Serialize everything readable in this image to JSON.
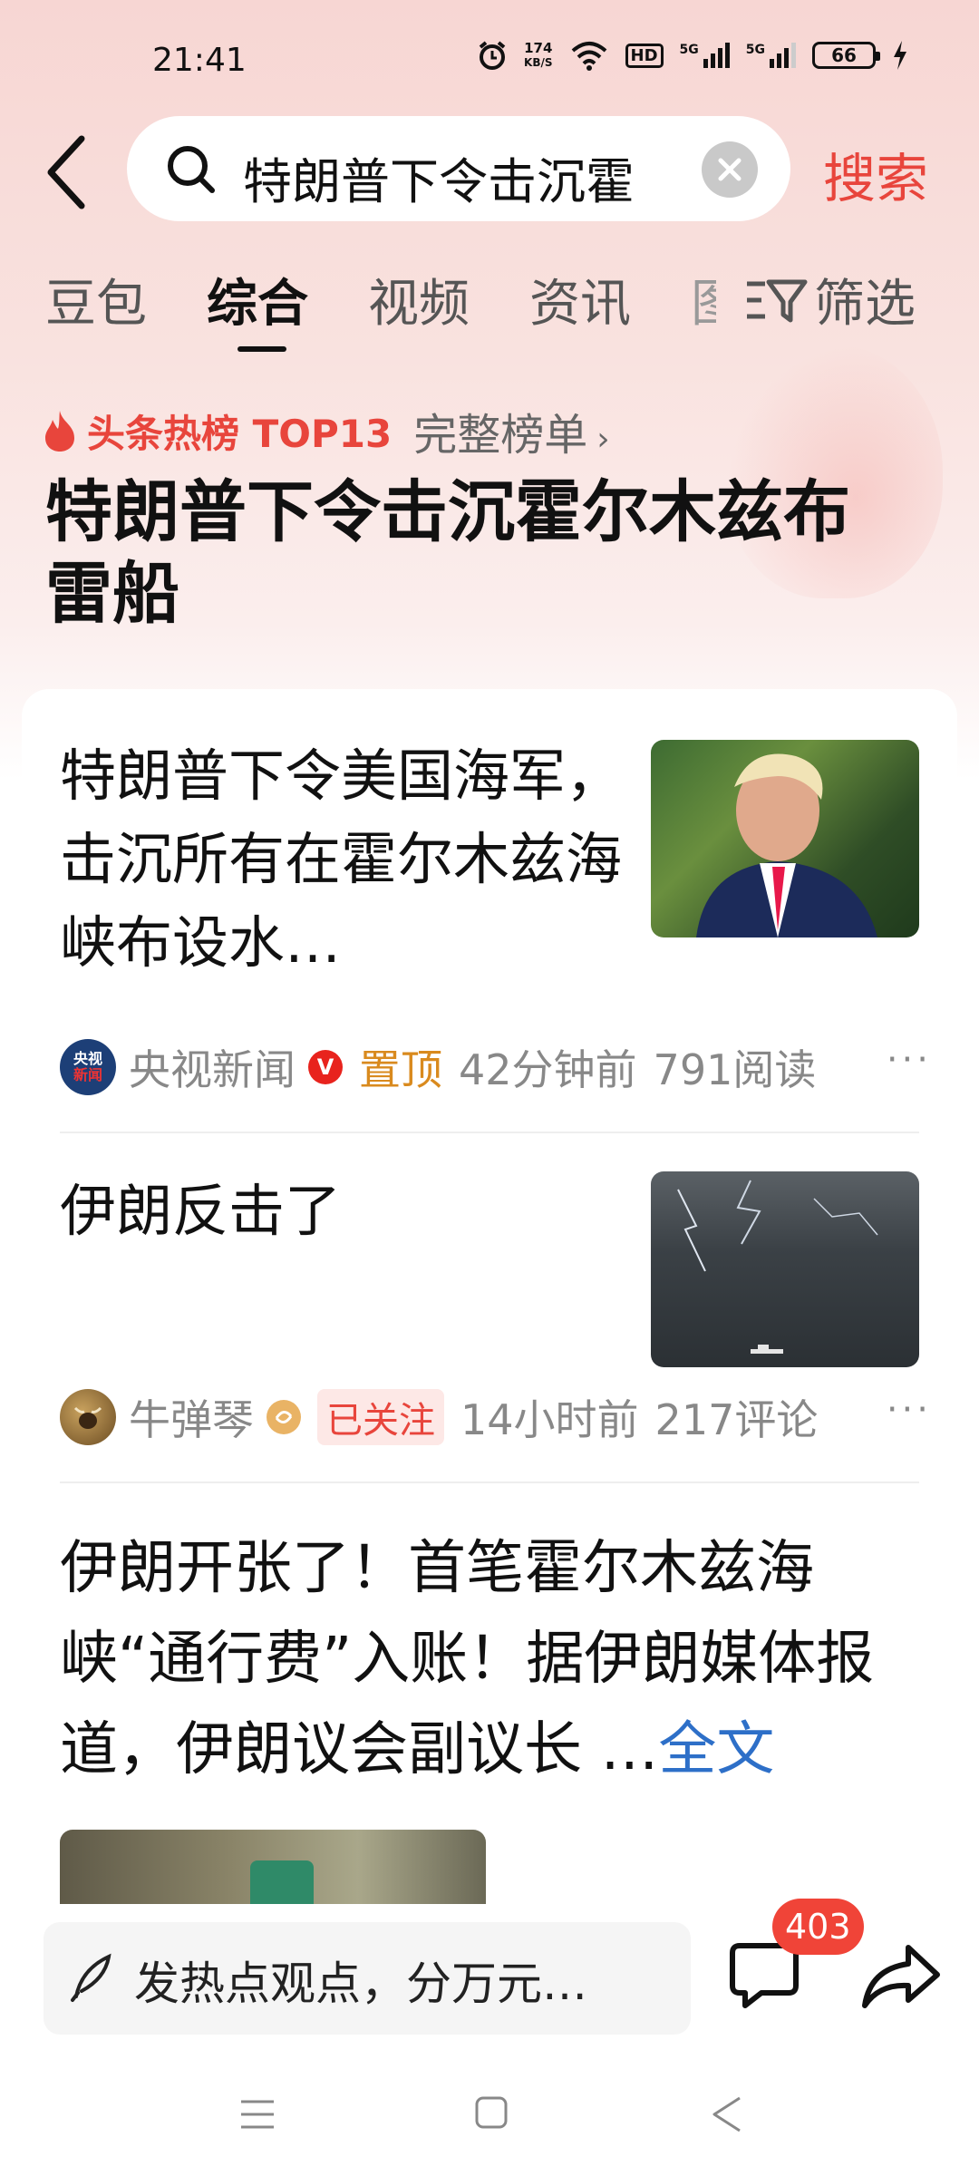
{
  "status_bar": {
    "time": "21:41",
    "net_speed_value": "174",
    "net_speed_unit": "KB/S",
    "hd_label": "HD",
    "signal1": "5G",
    "signal2": "5G",
    "battery": "66"
  },
  "search": {
    "query": "特朗普下令击沉霍",
    "submit_label": "搜索"
  },
  "tabs": {
    "items": [
      {
        "label": "豆包"
      },
      {
        "label": "综合"
      },
      {
        "label": "视频"
      },
      {
        "label": "资讯"
      },
      {
        "label": "图"
      }
    ],
    "active_index": 1,
    "filter_label": "筛选"
  },
  "hot": {
    "tag": "头条热榜 TOP13",
    "more_label": "完整榜单",
    "title": "特朗普下令击沉霍尔木兹布雷船"
  },
  "articles": [
    {
      "title": "特朗普下令美国海军，击沉所有在霍尔木兹海峡布设水…",
      "source": "央视新闻",
      "avatar_text1": "央视",
      "avatar_text2": "新闻",
      "verified_mark": "V",
      "pin_label": "置顶",
      "time": "42分钟前",
      "stat": "791阅读",
      "more": "···"
    },
    {
      "title": "伊朗反击了",
      "source": "牛弹琴",
      "follow_label": "已关注",
      "time": "14小时前",
      "stat": "217评论",
      "more": "···"
    },
    {
      "title": "伊朗开张了！首笔霍尔木兹海峡“通行费”入账！据伊朗媒体报道，伊朗议会副议长 …",
      "full_text_label": "全文"
    }
  ],
  "bottom": {
    "comment_placeholder": "发热点观点，分万元…",
    "comment_count": "403"
  },
  "colors": {
    "accent_red": "#e8453c",
    "link_blue": "#2d6fc8",
    "pin_orange": "#d98a1e"
  }
}
